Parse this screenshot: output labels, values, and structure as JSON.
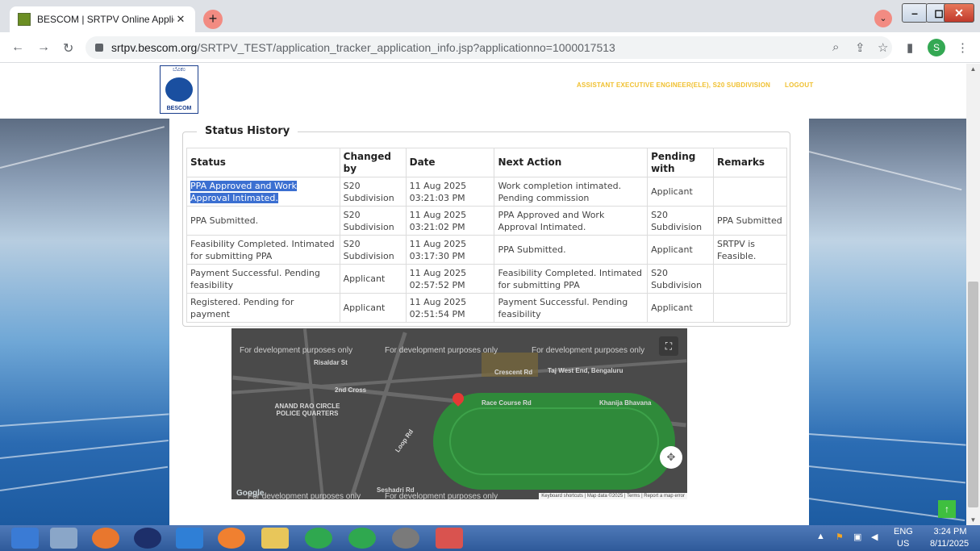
{
  "browser": {
    "tab_title": "BESCOM | SRTPV Online Applicati",
    "tab_close": "✕",
    "new_tab": "+",
    "tab_dropdown": "⌄",
    "minimize": "–",
    "maximize": "◻",
    "close": "✕",
    "url_host": "srtpv.bescom.org",
    "url_path": "/SRTPV_TEST/application_tracker_application_info.jsp?applicationno=1000017513",
    "profile_initial": "S"
  },
  "header": {
    "logo_top": "ಬೆವಿಕಂ",
    "logo_text": "BESCOM",
    "user_label": "ASSISTANT EXECUTIVE ENGINEER(ELE), S20 SUBDIVISION",
    "logout_label": "LOGOUT"
  },
  "status_history": {
    "legend": "Status History",
    "columns": [
      "Status",
      "Changed by",
      "Date",
      "Next Action",
      "Pending with",
      "Remarks"
    ],
    "rows": [
      {
        "status": "PPA Approved and Work Approval Intimated.",
        "changed_by": "S20 Subdivision",
        "date": "11 Aug 2025 03:21:03 PM",
        "next_action": "Work completion intimated. Pending commission",
        "pending_with": "Applicant",
        "remarks": ""
      },
      {
        "status": "PPA Submitted.",
        "changed_by": "S20 Subdivision",
        "date": "11 Aug 2025 03:21:02 PM",
        "next_action": "PPA Approved and Work Approval Intimated.",
        "pending_with": "S20 Subdivision",
        "remarks": "PPA Submitted"
      },
      {
        "status": "Feasibility Completed. Intimated for submitting PPA",
        "changed_by": "S20 Subdivision",
        "date": "11 Aug 2025 03:17:30 PM",
        "next_action": "PPA Submitted.",
        "pending_with": "Applicant",
        "remarks": "SRTPV is Feasible."
      },
      {
        "status": "Payment Successful. Pending feasibility",
        "changed_by": "Applicant",
        "date": "11 Aug 2025 02:57:52 PM",
        "next_action": "Feasibility Completed. Intimated for submitting PPA",
        "pending_with": "S20 Subdivision",
        "remarks": ""
      },
      {
        "status": "Registered. Pending for payment",
        "changed_by": "Applicant",
        "date": "11 Aug 2025 02:51:54 PM",
        "next_action": "Payment Successful. Pending feasibility",
        "pending_with": "Applicant",
        "remarks": ""
      }
    ]
  },
  "map": {
    "dev_text": "For development purposes only",
    "labels": [
      "Risaldar St",
      "Crescent Rd",
      "Taj West End, Bengaluru",
      "ANAND RAO CIRCLE POLICE QUARTERS",
      "Race Course Rd",
      "Khanija Bhavana",
      "Loop Rd",
      "Seshadri Rd",
      "2nd Cross"
    ],
    "fullscreen": "⛶",
    "pan": "✥",
    "google": "Google",
    "footer": "Keyboard shortcuts | Map data ©2025 | Terms | Report a map error"
  },
  "scroll_top_button": "↑",
  "taskbar": {
    "lang_top": "ENG",
    "lang_bottom": "US",
    "time": "3:24 PM",
    "date": "8/11/2025"
  }
}
